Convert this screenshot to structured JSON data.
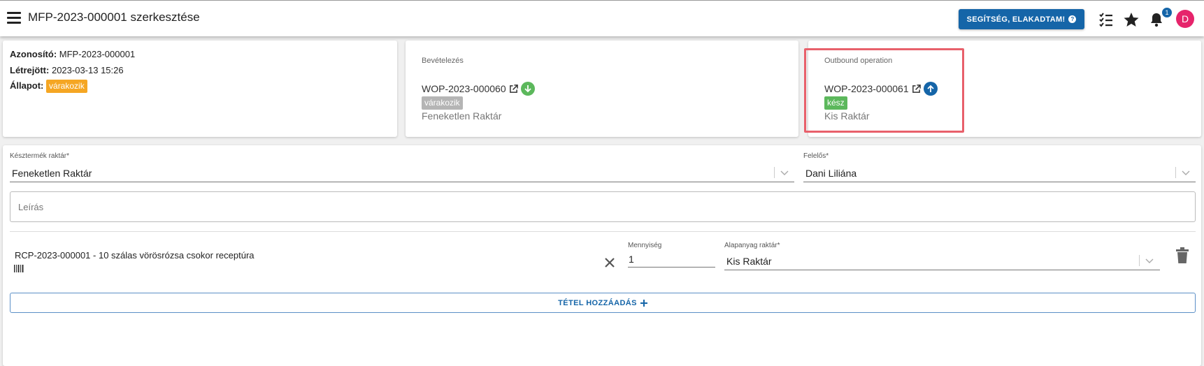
{
  "header": {
    "title": "MFP-2023-000001 szerkesztése",
    "help_label": "SEGÍTSÉG, ELAKADTAM!",
    "notification_count": "1",
    "avatar_initial": "D"
  },
  "info": {
    "id_label": "Azonosító:",
    "id_value": "MFP-2023-000001",
    "created_label": "Létrejött:",
    "created_value": "2023-03-13 15:26",
    "status_label": "Állapot:",
    "status_value": "várakozik"
  },
  "inbound": {
    "label": "Bevételezés",
    "code": "WOP-2023-000060",
    "status": "várakozik",
    "warehouse": "Feneketlen Raktár"
  },
  "outbound": {
    "label": "Outbound operation",
    "code": "WOP-2023-000061",
    "status": "kész",
    "warehouse": "Kis Raktár"
  },
  "form": {
    "product_wh_label": "Késztermék raktár",
    "product_wh_value": "Feneketlen Raktár",
    "responsible_label": "Felelős",
    "responsible_value": "Dani Liliána",
    "description_placeholder": "Leírás",
    "required_mark": "*"
  },
  "item": {
    "name": "RCP-2023-000001 - 10 szálas vörösrózsa csokor receptúra",
    "qty_label": "Mennyiség",
    "qty_value": "1",
    "raw_wh_label": "Alapanyag raktár",
    "raw_wh_value": "Kis Raktár"
  },
  "add_item_label": "TÉTEL HOZZÁADÁS",
  "colors": {
    "primary": "#1565a8",
    "orange": "#f5a623",
    "green": "#5cb85c",
    "highlight": "#e8606b",
    "avatar": "#e6246b"
  }
}
